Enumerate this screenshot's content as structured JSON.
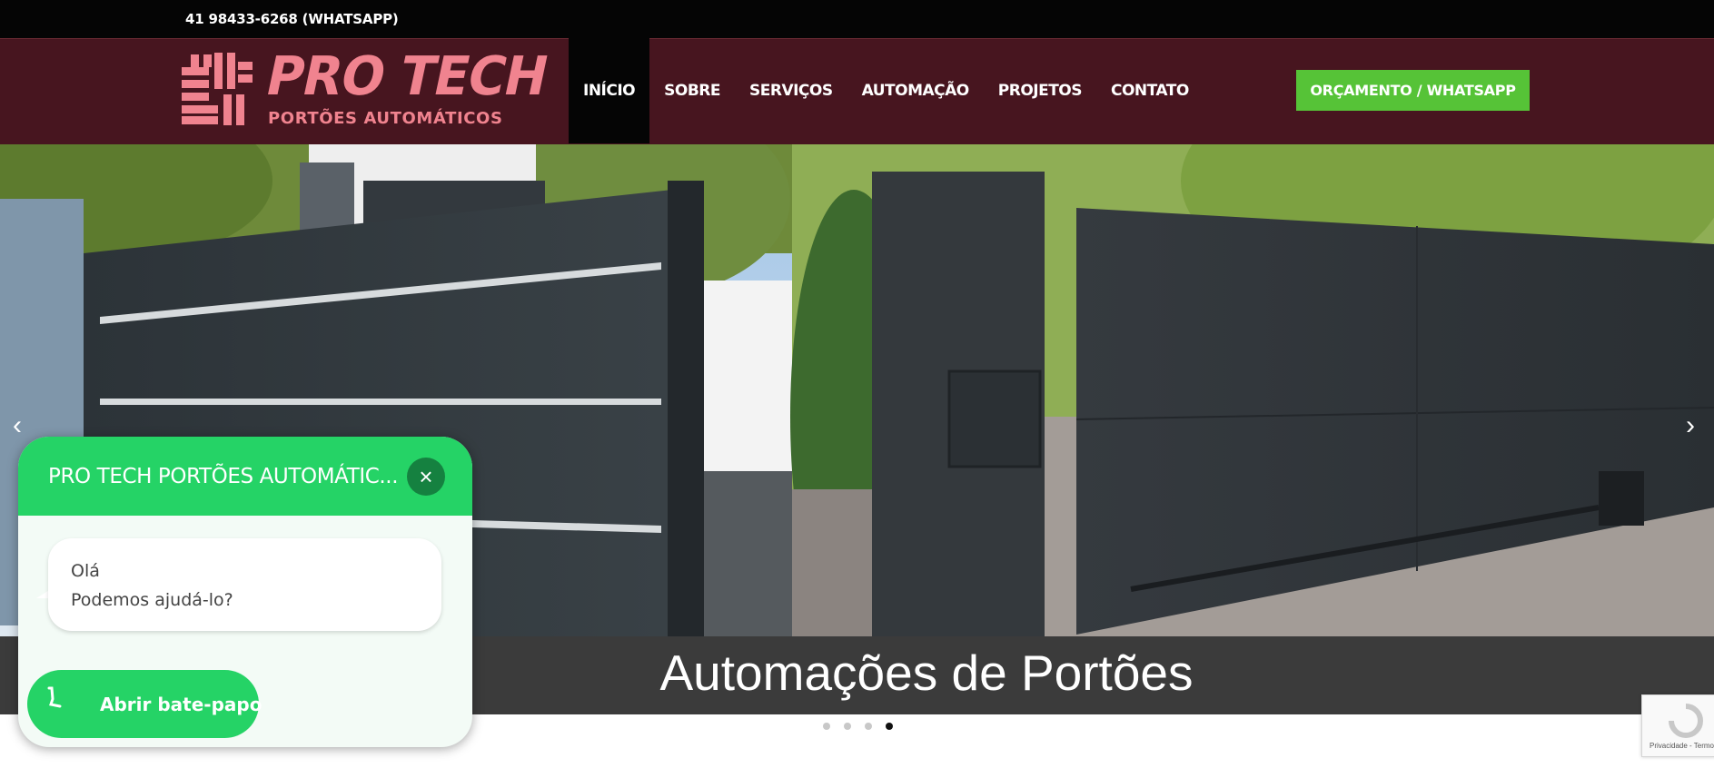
{
  "topbar": {
    "phone": "41 98433-6268 (WHATSAPP)"
  },
  "logo": {
    "title": "PRO TECH",
    "subtitle": "PORTÕES AUTOMÁTICOS"
  },
  "nav": {
    "items": [
      {
        "label": "INÍCIO"
      },
      {
        "label": "SOBRE"
      },
      {
        "label": "SERVIÇOS"
      },
      {
        "label": "AUTOMAÇÃO"
      },
      {
        "label": "PROJETOS"
      },
      {
        "label": "CONTATO"
      }
    ],
    "cta": "ORÇAMENTO / WHATSAPP"
  },
  "hero": {
    "caption": "Automações de Portões",
    "prev": "‹",
    "next": "›",
    "slides": 4,
    "active_slide": 4
  },
  "chat": {
    "title": "PRO TECH PORTÕES AUTOMÁTIC...",
    "close": "×",
    "greeting": "Olá",
    "message": "Podemos ajudá-lo?",
    "open_button": "Abrir bate-papo"
  },
  "recaptcha": {
    "text": "Privacidade - Termos"
  },
  "colors": {
    "nav_bg": "#47151f",
    "brand_pink": "#f0838f",
    "cta_green": "#56c337",
    "whatsapp_green": "#25d366"
  }
}
